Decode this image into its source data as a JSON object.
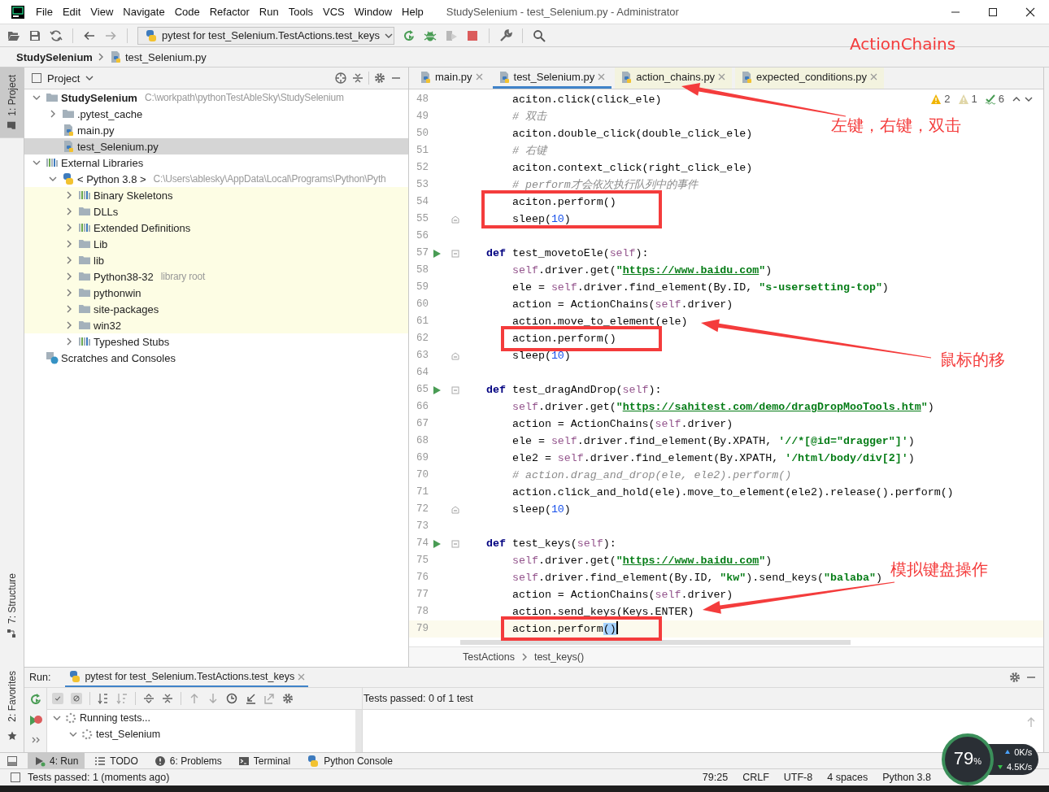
{
  "window": {
    "title": "StudySelenium - test_Selenium.py - Administrator"
  },
  "menu": [
    "File",
    "Edit",
    "View",
    "Navigate",
    "Code",
    "Refactor",
    "Run",
    "Tools",
    "VCS",
    "Window",
    "Help"
  ],
  "toolbar": {
    "run_configuration": "pytest for test_Selenium.TestActions.test_keys"
  },
  "breadcrumbs": [
    "StudySelenium",
    "test_Selenium.py"
  ],
  "side_tabs": [
    {
      "label": "1: Project",
      "kind": "project",
      "selected": true
    },
    {
      "label": "7: Structure",
      "kind": "structure",
      "selected": false
    },
    {
      "label": "2: Favorites",
      "kind": "favorites",
      "selected": false
    }
  ],
  "project": {
    "title": "Project",
    "tree": [
      {
        "label": "StudySelenium",
        "kind": "root",
        "hint": "C:\\workpath\\pythonTestAbleSky\\StudySelenium",
        "expanded": true,
        "selected": false,
        "library_scope": false,
        "children": [
          {
            "label": ".pytest_cache",
            "kind": "folder",
            "expanded": false,
            "selected": false,
            "library_scope": false
          },
          {
            "label": "main.py",
            "kind": "pyfile",
            "selected": false,
            "library_scope": false
          },
          {
            "label": "test_Selenium.py",
            "kind": "pyfile",
            "selected": true,
            "library_scope": false
          }
        ]
      },
      {
        "label": "External Libraries",
        "kind": "library",
        "expanded": true,
        "selected": false,
        "library_scope": false,
        "children": [
          {
            "label": "< Python 3.8 >",
            "kind": "python",
            "hint": "C:\\Users\\ablesky\\AppData\\Local\\Programs\\Python\\Pyth",
            "expanded": true,
            "selected": false,
            "library_scope": false,
            "children": [
              {
                "label": "Binary Skeletons",
                "kind": "library",
                "expanded": false,
                "selected": false,
                "library_scope": true
              },
              {
                "label": "DLLs",
                "kind": "folder",
                "expanded": false,
                "selected": false,
                "library_scope": true
              },
              {
                "label": "Extended Definitions",
                "kind": "library",
                "expanded": false,
                "selected": false,
                "library_scope": true
              },
              {
                "label": "Lib",
                "kind": "folder",
                "expanded": false,
                "selected": false,
                "library_scope": true
              },
              {
                "label": "lib",
                "kind": "folder",
                "expanded": false,
                "selected": false,
                "library_scope": true
              },
              {
                "label": "Python38-32",
                "kind": "folder",
                "hint": "library root",
                "expanded": false,
                "selected": false,
                "library_scope": true
              },
              {
                "label": "pythonwin",
                "kind": "folder",
                "expanded": false,
                "selected": false,
                "library_scope": true
              },
              {
                "label": "site-packages",
                "kind": "folder",
                "expanded": false,
                "selected": false,
                "library_scope": true
              },
              {
                "label": "win32",
                "kind": "folder",
                "expanded": false,
                "selected": false,
                "library_scope": true
              },
              {
                "label": "Typeshed Stubs",
                "kind": "library",
                "expanded": false,
                "selected": false,
                "library_scope": false
              }
            ]
          }
        ]
      },
      {
        "label": "Scratches and Consoles",
        "kind": "scratch",
        "selected": false,
        "library_scope": false
      }
    ]
  },
  "editor": {
    "tabs": [
      {
        "label": "main.py",
        "selected": false,
        "library": false
      },
      {
        "label": "test_Selenium.py",
        "selected": true,
        "library": false
      },
      {
        "label": "action_chains.py",
        "selected": false,
        "library": true
      },
      {
        "label": "expected_conditions.py",
        "selected": false,
        "library": true
      }
    ],
    "inspections": {
      "warnings": "2",
      "weak_warnings": "1",
      "typos": "6"
    },
    "lines": [
      {
        "number": "48",
        "kind": "body",
        "run": false,
        "current": false,
        "segments": [
          {
            "kind": "p",
            "text": "aciton.click(click_ele)"
          }
        ]
      },
      {
        "number": "49",
        "kind": "body",
        "run": false,
        "current": false,
        "segments": [
          {
            "kind": "com",
            "text": "# 双击"
          }
        ]
      },
      {
        "number": "50",
        "kind": "body",
        "run": false,
        "current": false,
        "segments": [
          {
            "kind": "p",
            "text": "aciton.double_click(double_click_ele)"
          }
        ]
      },
      {
        "number": "51",
        "kind": "body",
        "run": false,
        "current": false,
        "segments": [
          {
            "kind": "com",
            "text": "# 右键"
          }
        ]
      },
      {
        "number": "52",
        "kind": "body",
        "run": false,
        "current": false,
        "segments": [
          {
            "kind": "p",
            "text": "aciton.context_click(right_click_ele)"
          }
        ]
      },
      {
        "number": "53",
        "kind": "body",
        "run": false,
        "current": false,
        "segments": [
          {
            "kind": "com",
            "text": "# perform才会依次执行队列中的事件"
          }
        ]
      },
      {
        "number": "54",
        "kind": "body",
        "run": false,
        "current": false,
        "segments": [
          {
            "kind": "p",
            "text": "aciton.perform()"
          }
        ]
      },
      {
        "number": "55",
        "kind": "body_end",
        "run": false,
        "current": false,
        "segments": [
          {
            "kind": "p",
            "text": "sleep("
          },
          {
            "kind": "num",
            "text": "10"
          },
          {
            "kind": "p",
            "text": ")"
          }
        ]
      },
      {
        "number": "56",
        "kind": "blank",
        "run": false,
        "current": false
      },
      {
        "number": "57",
        "kind": "def",
        "run": true,
        "current": false,
        "segments": [
          {
            "kind": "kw",
            "text": "def"
          },
          {
            "kind": "p",
            "text": " test_movetoEle("
          },
          {
            "kind": "self",
            "text": "self"
          },
          {
            "kind": "p",
            "text": "):"
          }
        ]
      },
      {
        "number": "58",
        "kind": "body",
        "run": false,
        "current": false,
        "segments": [
          {
            "kind": "self",
            "text": "self"
          },
          {
            "kind": "p",
            "text": ".driver.get("
          },
          {
            "kind": "str",
            "text": "\""
          },
          {
            "kind": "url",
            "text": "https://www.baidu.com"
          },
          {
            "kind": "str",
            "text": "\""
          },
          {
            "kind": "p",
            "text": ")"
          }
        ]
      },
      {
        "number": "59",
        "kind": "body",
        "run": false,
        "current": false,
        "segments": [
          {
            "kind": "p",
            "text": "ele = "
          },
          {
            "kind": "self",
            "text": "self"
          },
          {
            "kind": "p",
            "text": ".driver.find_element(By.ID, "
          },
          {
            "kind": "str",
            "text": "\"s-usersetting-top\""
          },
          {
            "kind": "p",
            "text": ")"
          }
        ]
      },
      {
        "number": "60",
        "kind": "body",
        "run": false,
        "current": false,
        "segments": [
          {
            "kind": "p",
            "text": "action = ActionChains("
          },
          {
            "kind": "self",
            "text": "self"
          },
          {
            "kind": "p",
            "text": ".driver)"
          }
        ]
      },
      {
        "number": "61",
        "kind": "body",
        "run": false,
        "current": false,
        "segments": [
          {
            "kind": "p",
            "text": "action.move_to_element(ele)"
          }
        ]
      },
      {
        "number": "62",
        "kind": "body",
        "run": false,
        "current": false,
        "segments": [
          {
            "kind": "p",
            "text": "action.perform()"
          }
        ]
      },
      {
        "number": "63",
        "kind": "body_end",
        "run": false,
        "current": false,
        "segments": [
          {
            "kind": "p",
            "text": "sleep("
          },
          {
            "kind": "num",
            "text": "10"
          },
          {
            "kind": "p",
            "text": ")"
          }
        ]
      },
      {
        "number": "64",
        "kind": "blank",
        "run": false,
        "current": false
      },
      {
        "number": "65",
        "kind": "def",
        "run": true,
        "current": false,
        "segments": [
          {
            "kind": "kw",
            "text": "def"
          },
          {
            "kind": "p",
            "text": " test_dragAndDrop("
          },
          {
            "kind": "self",
            "text": "self"
          },
          {
            "kind": "p",
            "text": "):"
          }
        ]
      },
      {
        "number": "66",
        "kind": "body",
        "run": false,
        "current": false,
        "segments": [
          {
            "kind": "self",
            "text": "self"
          },
          {
            "kind": "p",
            "text": ".driver.get("
          },
          {
            "kind": "str",
            "text": "\""
          },
          {
            "kind": "url",
            "text": "https://sahitest.com/demo/dragDropMooTools.htm"
          },
          {
            "kind": "str",
            "text": "\""
          },
          {
            "kind": "p",
            "text": ")"
          }
        ]
      },
      {
        "number": "67",
        "kind": "body",
        "run": false,
        "current": false,
        "segments": [
          {
            "kind": "p",
            "text": "action = ActionChains("
          },
          {
            "kind": "self",
            "text": "self"
          },
          {
            "kind": "p",
            "text": ".driver)"
          }
        ]
      },
      {
        "number": "68",
        "kind": "body",
        "run": false,
        "current": false,
        "segments": [
          {
            "kind": "p",
            "text": "ele = "
          },
          {
            "kind": "self",
            "text": "self"
          },
          {
            "kind": "p",
            "text": ".driver.find_element(By.XPATH, "
          },
          {
            "kind": "str",
            "text": "'//*[@id=\"dragger\"]'"
          },
          {
            "kind": "p",
            "text": ")"
          }
        ]
      },
      {
        "number": "69",
        "kind": "body",
        "run": false,
        "current": false,
        "segments": [
          {
            "kind": "p",
            "text": "ele2 = "
          },
          {
            "kind": "self",
            "text": "self"
          },
          {
            "kind": "p",
            "text": ".driver.find_element(By.XPATH, "
          },
          {
            "kind": "str",
            "text": "'/html/body/div[2]'"
          },
          {
            "kind": "p",
            "text": ")"
          }
        ]
      },
      {
        "number": "70",
        "kind": "body",
        "run": false,
        "current": false,
        "segments": [
          {
            "kind": "com",
            "text": "# action.drag_and_drop(ele, ele2).perform()"
          }
        ]
      },
      {
        "number": "71",
        "kind": "body",
        "run": false,
        "current": false,
        "segments": [
          {
            "kind": "p",
            "text": "action.click_and_hold(ele).move_to_element(ele2).release().perform()"
          }
        ]
      },
      {
        "number": "72",
        "kind": "body_end",
        "run": false,
        "current": false,
        "segments": [
          {
            "kind": "p",
            "text": "sleep("
          },
          {
            "kind": "num",
            "text": "10"
          },
          {
            "kind": "p",
            "text": ")"
          }
        ]
      },
      {
        "number": "73",
        "kind": "blank",
        "run": false,
        "current": false
      },
      {
        "number": "74",
        "kind": "def",
        "run": true,
        "current": false,
        "segments": [
          {
            "kind": "kw",
            "text": "def"
          },
          {
            "kind": "p",
            "text": " test_keys("
          },
          {
            "kind": "self",
            "text": "self"
          },
          {
            "kind": "p",
            "text": "):"
          }
        ]
      },
      {
        "number": "75",
        "kind": "body",
        "run": false,
        "current": false,
        "segments": [
          {
            "kind": "self",
            "text": "self"
          },
          {
            "kind": "p",
            "text": ".driver.get("
          },
          {
            "kind": "str",
            "text": "\""
          },
          {
            "kind": "url",
            "text": "https://www.baidu.com"
          },
          {
            "kind": "str",
            "text": "\""
          },
          {
            "kind": "p",
            "text": ")"
          }
        ]
      },
      {
        "number": "76",
        "kind": "body",
        "run": false,
        "current": false,
        "segments": [
          {
            "kind": "self",
            "text": "self"
          },
          {
            "kind": "p",
            "text": ".driver.find_element(By.ID, "
          },
          {
            "kind": "str",
            "text": "\"kw\""
          },
          {
            "kind": "p",
            "text": ").send_keys("
          },
          {
            "kind": "str",
            "text": "\"balaba\""
          },
          {
            "kind": "p",
            "text": ")"
          }
        ]
      },
      {
        "number": "77",
        "kind": "body",
        "run": false,
        "current": false,
        "segments": [
          {
            "kind": "p",
            "text": "action = ActionChains("
          },
          {
            "kind": "self",
            "text": "self"
          },
          {
            "kind": "p",
            "text": ".driver)"
          }
        ]
      },
      {
        "number": "78",
        "kind": "body",
        "run": false,
        "current": false,
        "segments": [
          {
            "kind": "p",
            "text": "action.send_keys(Keys.ENTER)"
          }
        ]
      },
      {
        "number": "79",
        "kind": "body",
        "run": false,
        "current": true,
        "segments": [
          {
            "kind": "p",
            "text": "action.perform"
          },
          {
            "kind": "sel",
            "text": "()"
          }
        ]
      }
    ],
    "breadcrumbs": [
      "TestActions",
      "test_keys()"
    ]
  },
  "run": {
    "label": "Run:",
    "tab": "pytest for test_Selenium.TestActions.test_keys",
    "summary": "Tests passed: **0** of 1 test",
    "tree": [
      {
        "label": "Running tests...",
        "expanded": true,
        "children": [
          {
            "label": "test_Selenium",
            "expanded": true
          }
        ]
      }
    ]
  },
  "tool_tabs": [
    {
      "label": "4: Run",
      "kind": "run",
      "selected": true
    },
    {
      "label": "TODO",
      "kind": "todo",
      "selected": false
    },
    {
      "label": "6: Problems",
      "kind": "problems",
      "selected": false
    },
    {
      "label": "Terminal",
      "kind": "terminal",
      "selected": false
    },
    {
      "label": "Python Console",
      "kind": "console",
      "selected": false
    }
  ],
  "status_bar": {
    "message": "Tests passed: 1 (moments ago)",
    "items": [
      "79:25",
      "CRLF",
      "UTF-8",
      "4 spaces",
      "Python 3.8"
    ]
  },
  "net_monitor": {
    "load": "79",
    "unit": "%",
    "upload": "0K/s",
    "download": "4.5K/s"
  },
  "annotations": {
    "title": "ActionChains",
    "notes": [
      "左键，右键，双击",
      "鼠标的移",
      "模拟键盘操作"
    ]
  }
}
